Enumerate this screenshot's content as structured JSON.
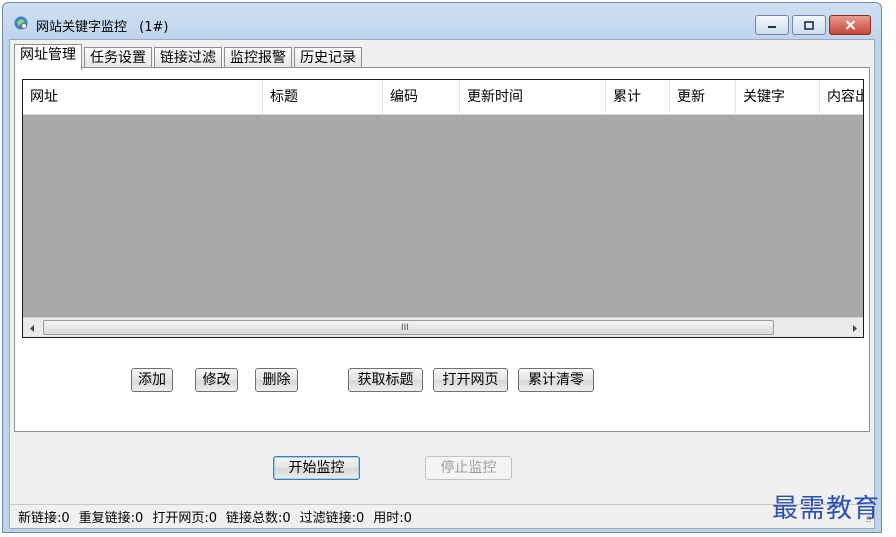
{
  "window": {
    "title": "网站关键字监控",
    "instance": "(1#)"
  },
  "tabs": [
    {
      "label": "网址管理",
      "active": true
    },
    {
      "label": "任务设置",
      "active": false
    },
    {
      "label": "链接过滤",
      "active": false
    },
    {
      "label": "监控报警",
      "active": false
    },
    {
      "label": "历史记录",
      "active": false
    }
  ],
  "table": {
    "columns": [
      "网址",
      "标题",
      "编码",
      "更新时间",
      "累计",
      "更新",
      "关键字",
      "内容出"
    ],
    "rows": []
  },
  "actions": {
    "add": "添加",
    "edit": "修改",
    "delete": "删除",
    "fetch_title": "获取标题",
    "open_page": "打开网页",
    "reset_count": "累计清零"
  },
  "controls": {
    "start": "开始监控",
    "stop": "停止监控"
  },
  "status": {
    "new_links": "新链接:0",
    "duplicate_links": "重复链接:0",
    "opened_pages": "打开网页:0",
    "total_links": "链接总数:0",
    "filtered_links": "过滤链接:0",
    "elapsed": "用时:0"
  },
  "scrollbar": {
    "grip": "III"
  },
  "watermark": "最需教育",
  "colors": {
    "titlebar": "#bdd3ec",
    "list_background": "#a9a9a9",
    "close_button": "#c5463a",
    "watermark": "#2a4fb6"
  },
  "icons": [
    "app-logo-icon",
    "minimize-icon",
    "maximize-icon",
    "close-icon",
    "scroll-left-icon",
    "scroll-right-icon",
    "resize-grip-icon"
  ]
}
